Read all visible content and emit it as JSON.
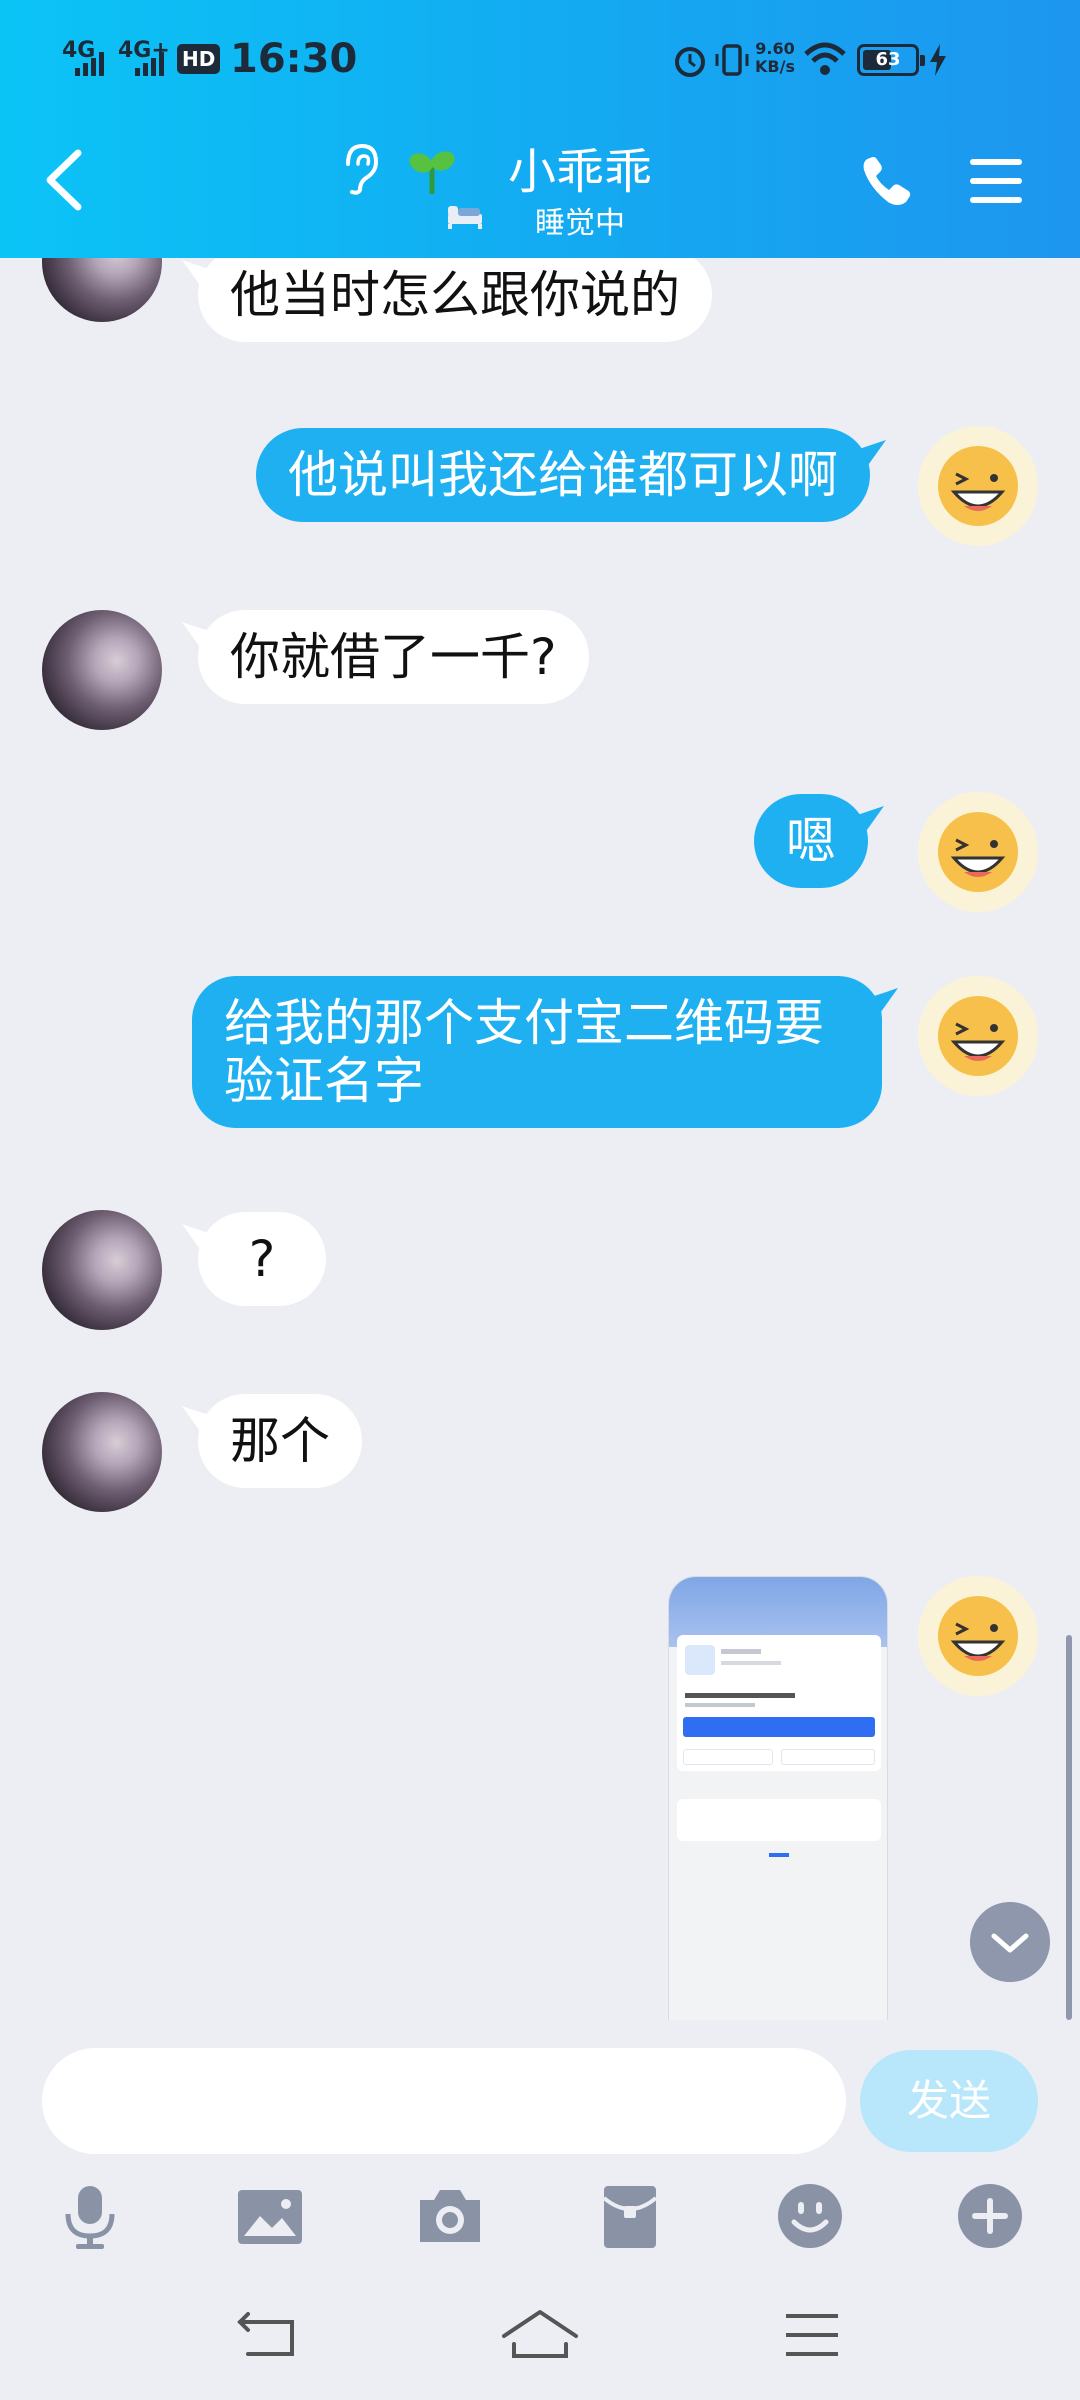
{
  "status_bar": {
    "network_1": "4G",
    "network_2": "4G+",
    "hd_badge": "HD",
    "time": "16:30",
    "speed_value": "9.60",
    "speed_unit": "KB/s",
    "battery": "63"
  },
  "header": {
    "title": "小乖乖",
    "status": "睡觉中"
  },
  "messages": [
    {
      "side": "in",
      "text": "他当时怎么跟你说的"
    },
    {
      "side": "out",
      "text": "他说叫我还给谁都可以啊"
    },
    {
      "side": "in",
      "text": "你就借了一千?"
    },
    {
      "side": "out",
      "text": "嗯"
    },
    {
      "side": "out",
      "text": "给我的那个支付宝二维码要验证名字"
    },
    {
      "side": "in",
      "text": "?"
    },
    {
      "side": "in",
      "text": "那个"
    },
    {
      "side": "out",
      "type": "image",
      "text": ""
    }
  ],
  "input": {
    "placeholder": "",
    "send_label": "发送"
  },
  "toolbar": [
    "microphone-icon",
    "image-icon",
    "camera-icon",
    "red-packet-icon",
    "emoji-icon",
    "plus-icon"
  ],
  "colors": {
    "header_start": "#0bc4f6",
    "header_end": "#1d96ef",
    "bubble_out": "#1fb0f2",
    "bubble_in": "#ffffff",
    "background": "#eceef4"
  }
}
